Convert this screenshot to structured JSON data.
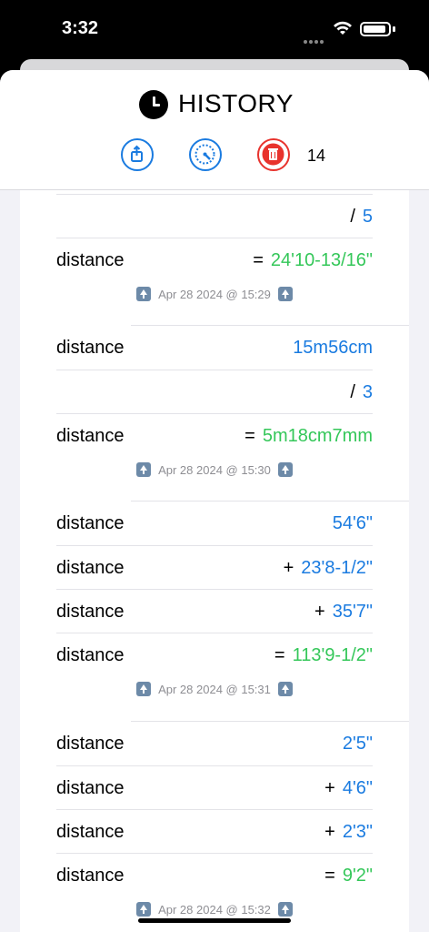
{
  "status": {
    "time": "3:32"
  },
  "header": {
    "title": "HISTORY",
    "count": "14"
  },
  "blocks": [
    {
      "rows": [
        {
          "label": "",
          "op": "/",
          "value": "5",
          "kind": "num"
        },
        {
          "label": "distance",
          "op": "=",
          "value": "24'10-13/16\"",
          "kind": "res"
        }
      ],
      "stamp": "Apr 28 2024 @ 15:29"
    },
    {
      "rows": [
        {
          "label": "distance",
          "op": "",
          "value": "15m56cm",
          "kind": "num"
        },
        {
          "label": "",
          "op": "/",
          "value": "3",
          "kind": "num"
        },
        {
          "label": "distance",
          "op": "=",
          "value": "5m18cm7mm",
          "kind": "res"
        }
      ],
      "stamp": "Apr 28 2024 @ 15:30"
    },
    {
      "rows": [
        {
          "label": "distance",
          "op": "",
          "value": "54'6\"",
          "kind": "num"
        },
        {
          "label": "distance",
          "op": "+",
          "value": "23'8-1/2\"",
          "kind": "num"
        },
        {
          "label": "distance",
          "op": "+",
          "value": "35'7\"",
          "kind": "num"
        },
        {
          "label": "distance",
          "op": "=",
          "value": "113'9-1/2\"",
          "kind": "res"
        }
      ],
      "stamp": "Apr 28 2024 @ 15:31"
    },
    {
      "rows": [
        {
          "label": "distance",
          "op": "",
          "value": "2'5\"",
          "kind": "num"
        },
        {
          "label": "distance",
          "op": "+",
          "value": "4'6\"",
          "kind": "num"
        },
        {
          "label": "distance",
          "op": "+",
          "value": "2'3\"",
          "kind": "num"
        },
        {
          "label": "distance",
          "op": "=",
          "value": "9'2\"",
          "kind": "res"
        }
      ],
      "stamp": "Apr 28 2024 @ 15:32"
    }
  ],
  "icons": {
    "title": "clock-icon",
    "share": "share-icon",
    "gauge": "gauge-icon",
    "trash": "trash-icon",
    "stamp": "arrow-up-icon"
  },
  "colors": {
    "accent": "#1a7be0",
    "result": "#34c759",
    "delete": "#e8332d"
  }
}
